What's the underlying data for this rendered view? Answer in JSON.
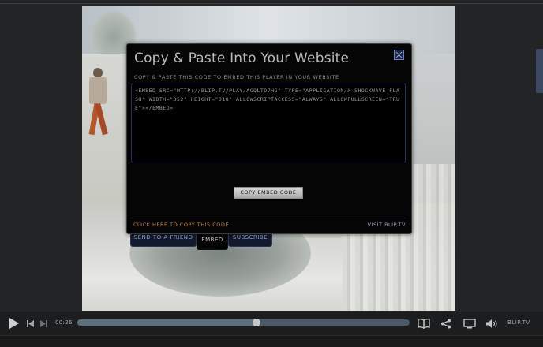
{
  "modal": {
    "title": "Copy & Paste Into Your Website",
    "subtitle": "Copy & Paste this code to embed this player in your website",
    "embed_code": "<EMBED SRC=\"HTTP://BLIP.TV/PLAY/ACQLTO7HG\" TYPE=\"APPLICATION/X-SHOCKWAVE-FLASH\" WIDTH=\"352\" HEIGHT=\"318\" ALLOWSCRIPTACCESS=\"ALWAYS\" ALLOWFULLSCREEN=\"TRUE\"></EMBED>",
    "copy_button_label": "Copy Embed Code",
    "copy_link_label": "Click here to copy this code",
    "visit_link_label": "Visit Blip.tv",
    "close_icon": "close-x-icon"
  },
  "tabs": [
    {
      "label": "Send to a friend",
      "active": false
    },
    {
      "label": "Embed",
      "active": true
    },
    {
      "label": "Subscribe",
      "active": false
    }
  ],
  "controls": {
    "time": "00:26",
    "progress_fraction": 0.54,
    "brand": "BLIP.TV",
    "icons": [
      "play-icon",
      "previous-icon",
      "next-icon",
      "book-icon",
      "share-icon",
      "screen-icon",
      "volume-icon"
    ]
  },
  "colors": {
    "modal_bg": "#050505",
    "link_orange": "#c48a35",
    "tab_blue": "#141a2e",
    "track": "#4b5a66"
  }
}
